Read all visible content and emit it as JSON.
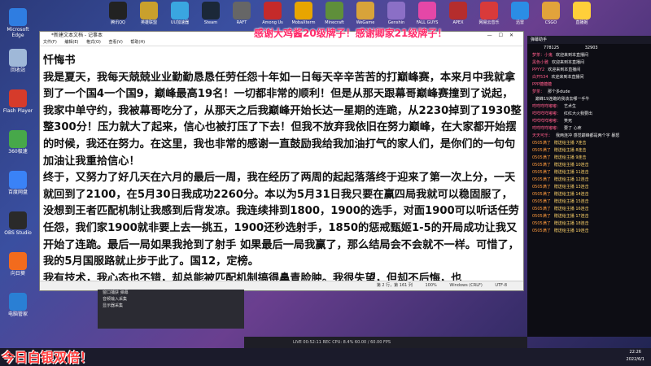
{
  "desktop_left": [
    {
      "label": "Microsoft Edge",
      "color": "#2f7de1"
    },
    {
      "label": "回收站",
      "color": "#9fb8d8"
    },
    {
      "label": "Flash Player",
      "color": "#d63b2b"
    },
    {
      "label": "360极速",
      "color": "#47a84a"
    },
    {
      "label": "百度网盘",
      "color": "#3a82f7"
    },
    {
      "label": "OBS Studio",
      "color": "#2a2a2a"
    },
    {
      "label": "向日葵",
      "color": "#f26b1d"
    },
    {
      "label": "电脑管家",
      "color": "#2a7fd4"
    }
  ],
  "desktop_top": [
    {
      "label": "腾讯QQ",
      "color": "#222"
    },
    {
      "label": "英雄联盟",
      "color": "#c9a02d"
    },
    {
      "label": "UU加速器",
      "color": "#3aa6e0"
    },
    {
      "label": "Steam",
      "color": "#1b2838"
    },
    {
      "label": "RAFT",
      "color": "#666"
    },
    {
      "label": "Among Us",
      "color": "#c52a2a"
    },
    {
      "label": "MobaXterm",
      "color": "#e8a500"
    },
    {
      "label": "Minecraft",
      "color": "#5f8f3a"
    },
    {
      "label": "WeGame",
      "color": "#d8a33a"
    },
    {
      "label": "Genshin",
      "color": "#8b6fc6"
    },
    {
      "label": "FALL GUYS",
      "color": "#e547a7"
    },
    {
      "label": "APEX",
      "color": "#b52d2d"
    },
    {
      "label": "网易云音乐",
      "color": "#d93a3a"
    },
    {
      "label": "迅雷",
      "color": "#2b8de5"
    },
    {
      "label": "CSGO",
      "color": "#e2a33b"
    },
    {
      "label": "直播姬",
      "color": "#ffcf3a"
    }
  ],
  "top_banner": "感谢大鸡酱20级牌子！感谢卿家21级牌子！",
  "bottom_banner": "今日白银双倍！",
  "notepad": {
    "title": "*新建文本文档 - 记事本",
    "menu": [
      "文件(F)",
      "编辑(E)",
      "格式(O)",
      "查看(V)",
      "帮助(H)"
    ],
    "paragraphs": [
      "忏悔书",
      "我是夏天，我每天兢兢业业勤勤恳恳任劳任怨十年如一日每天辛辛苦苦的打巅峰赛，本来月中我就拿到了一个国4一个国9，巅峰最高19名！一切都非常的顺利！但是从那天跟幕哥巅峰赛撞到了说起，我家中单守约，我被幕哥吃分了，从那天之后我巅峰开始长达一星期的连跪，从2230掉到了1930整整300分！压力就大了起来，信心也被打压了下去！但我不放弃我依旧在努力巅峰，在大家都开始摆的时候，我还在努力。在这里，我也非常的感谢一直鼓励我给我加油打气的家人们，是你们的一句句加油让我重拾信心！",
      "终于，又努力了好几天在六月的最后一周，我在经历了两周的起起落落终于迎来了第一次上分，一天就回到了2100，在5月30日我成功2260分。本以为5月31日我只要在赢四局我就可以稳固服了，没想到王者匹配机制让我感到后背发凉。我连续排到1800，1900的选手，对面1900可以听话任劳任怨，我们家1900就非要上去一挑五，1900还秒选射手，1850的惩戒甄姬1-5的开局成功让我又开始了连跪。最后一局如果我抢到了射手 如果最后一局我赢了，那么结局会不会就不一样。可惜了，我的5月国服路就止步于此了。国12，定榜。",
      "我有技术，我心态也不错，却总能被匹配机制搞得鼻青脸肿。我很失望，但却不后悔，也"
    ],
    "status": [
      "第 2 行，第 161 列",
      "100%",
      "Windows (CRLF)",
      "UTF-8"
    ]
  },
  "chat": {
    "title": "弹幕助手",
    "stats": [
      "778125",
      "32903"
    ],
    "rows": [
      {
        "user": "梦茶：小鬼",
        "msg": "欢迎来到本直播间",
        "gift": false
      },
      {
        "user": "黑色小雅",
        "msg": "欢迎来到本直播间",
        "gift": false
      },
      {
        "user": "PPYY2",
        "msg": "欢迎来到本直播间",
        "gift": false
      },
      {
        "user": "白开534",
        "msg": "欢迎来到本直播间",
        "gift": false
      },
      {
        "user": "PPP糖糖糖",
        "msg": "",
        "gift": false
      },
      {
        "user": "梦茶：",
        "msg": "那个多dude",
        "gift": false
      },
      {
        "user": "",
        "msg": "巅峰19连跪的我该去哪一手牛",
        "gift": false
      },
      {
        "user": "咩咩咩咩嘟嘟：",
        "msg": "艺术生",
        "gift": false
      },
      {
        "user": "咩咩咩咩嘟嘟：",
        "msg": "红红大火我要出",
        "gift": false
      },
      {
        "user": "咩咩咩咩嘟嘟：",
        "msg": "笑死",
        "gift": false
      },
      {
        "user": "咩咩咩咩嘟嘟：",
        "msg": "要了 心疼",
        "gift": false
      },
      {
        "user": "天天可乐：",
        "msg": "我两连冲 感觉巅峰都是两个字 暴怒",
        "gift": false
      },
      {
        "user": "0505满了",
        "msg": "赠送给主播 7连击",
        "gift": true
      },
      {
        "user": "0505满了",
        "msg": "赠送给主播 8连击",
        "gift": true
      },
      {
        "user": "0505满了",
        "msg": "赠送给主播 9连击",
        "gift": true
      },
      {
        "user": "0505满了",
        "msg": "赠送给主播 10连击",
        "gift": true
      },
      {
        "user": "0505满了",
        "msg": "赠送给主播 11连击",
        "gift": true
      },
      {
        "user": "0505满了",
        "msg": "赠送给主播 12连击",
        "gift": true
      },
      {
        "user": "0505满了",
        "msg": "赠送给主播 13连击",
        "gift": true
      },
      {
        "user": "0505满了",
        "msg": "赠送给主播 14连击",
        "gift": true
      },
      {
        "user": "0505满了",
        "msg": "赠送给主播 15连击",
        "gift": true
      },
      {
        "user": "0505满了",
        "msg": "赠送给主播 16连击",
        "gift": true
      },
      {
        "user": "0505满了",
        "msg": "赠送给主播 17连击",
        "gift": true
      },
      {
        "user": "0505满了",
        "msg": "赠送给主播 18连击",
        "gift": true
      },
      {
        "user": "0505满了",
        "msg": "赠送给主播 19连击",
        "gift": true
      }
    ]
  },
  "obs_sources": [
    "窗口捕获 弹幕",
    "音频输入采集",
    "显示器采集"
  ],
  "streambar": "LIVE 00:52:11  REC  CPU: 8.4%  60.00 / 60.00 FPS",
  "clock": {
    "time": "22:26",
    "date": "2022/6/1"
  }
}
